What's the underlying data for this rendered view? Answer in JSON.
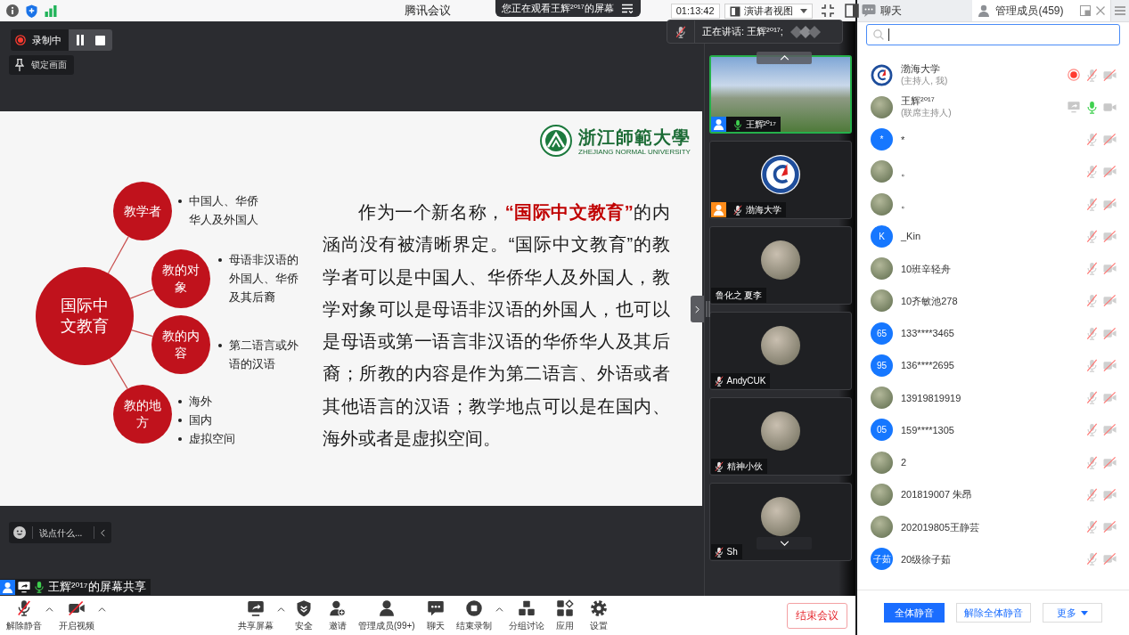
{
  "top_bar": {
    "title": "腾讯会议",
    "viewing_notice": "您正在观看王辉²⁰¹⁷的屏幕",
    "timer": "01:13:42",
    "view_mode": "演讲者视图"
  },
  "recording": {
    "label": "录制中",
    "lock_label": "锁定画面"
  },
  "speaking": {
    "label": "正在讲话: 王辉²⁰¹⁷;"
  },
  "slide": {
    "logo": {
      "title": "浙江師範大學",
      "subtitle": "ZHEJIANG NORMAL UNIVERSITY"
    },
    "mind_map": {
      "center": "国际中文教育",
      "branches": [
        {
          "label": "教学者",
          "points": [
            "中国人、华侨华人及外国人"
          ]
        },
        {
          "label": "教的对象",
          "points": [
            "母语非汉语的外国人、华侨及其后裔"
          ]
        },
        {
          "label": "教的内容",
          "points": [
            "第二语言或外语的汉语"
          ]
        },
        {
          "label": "教的地方",
          "points": [
            "海外",
            "国内",
            "虚拟空间"
          ]
        }
      ]
    },
    "paragraph": "作为一个新名称，**“国际中文教育”**的内涵尚没有被清晰界定。“国际中文教育”的教学者可以是中国人、华侨华人及外国人，教学对象可以是母语非汉语的外国人，也可以是母语或第一语言非汉语的华侨华人及其后裔；所教的内容是作为第二语言、外语或者其他语言的汉语；教学地点可以是在国内、海外或者是虚拟空间。"
  },
  "video_tiles": [
    {
      "name": "王辉²⁰¹⁷",
      "kind": "video",
      "active": true,
      "color": "#1677ff",
      "mic": {
        "muted": false
      }
    },
    {
      "name": "渤海大学",
      "kind": "logo",
      "active": false,
      "color": "#ff8c1a",
      "mic": {
        "muted": true
      }
    },
    {
      "name": "鲁化之 夏李",
      "kind": "avatar",
      "active": false
    },
    {
      "name": "AndyCUK",
      "kind": "avatar",
      "active": false,
      "mic": {
        "muted": true
      }
    },
    {
      "name": "精神小伙",
      "kind": "avatar",
      "active": false,
      "mic": {
        "muted": true
      }
    },
    {
      "name": "Sh",
      "kind": "avatar",
      "active": false,
      "mic": {
        "muted": true
      }
    }
  ],
  "quick_chat": {
    "placeholder": "说点什么..."
  },
  "screen_share": {
    "label": "王辉²⁰¹⁷的屏幕共享"
  },
  "toolbar": {
    "left": [
      {
        "kind": "mic_off",
        "label": "解除静音",
        "menu": true
      },
      {
        "kind": "camera_off",
        "label": "开启视频",
        "menu": true
      }
    ],
    "center": [
      {
        "kind": "share",
        "label": "共享屏幕",
        "menu": true
      },
      {
        "kind": "security",
        "label": "安全",
        "menu": false
      },
      {
        "kind": "invite",
        "label": "邀请",
        "menu": false
      },
      {
        "kind": "members",
        "label": "管理成员(99+)",
        "menu": false
      },
      {
        "kind": "chat",
        "label": "聊天",
        "menu": false
      },
      {
        "kind": "record",
        "label": "结束录制",
        "menu": true
      },
      {
        "kind": "breakout",
        "label": "分组讨论",
        "menu": false
      },
      {
        "kind": "apps",
        "label": "应用",
        "menu": false
      },
      {
        "kind": "settings",
        "label": "设置",
        "menu": false
      }
    ],
    "end_button": "结束会议"
  },
  "side_panel": {
    "tabs": [
      {
        "kind": "chat",
        "label": "聊天",
        "selected": false
      },
      {
        "kind": "members",
        "label": "管理成员(459)",
        "selected": true
      }
    ],
    "search": {
      "focused": true
    },
    "members": [
      {
        "name": "渤海大学",
        "role": "(主持人, 我)",
        "avatar": {
          "kind": "logo"
        },
        "recording": true,
        "sharing": false,
        "muted": true,
        "camera_on": false
      },
      {
        "name": "王辉²⁰¹⁷",
        "role": "(联席主持人)",
        "avatar": {
          "kind": "photo"
        },
        "recording": false,
        "sharing": true,
        "muted": false,
        "camera_on": true
      },
      {
        "name": "*",
        "avatar": {
          "kind": "initials",
          "text": "*"
        },
        "recording": false,
        "sharing": false,
        "muted": true,
        "camera_on": false
      },
      {
        "name": "。",
        "avatar": {
          "kind": "photo"
        },
        "recording": false,
        "sharing": false,
        "muted": true,
        "camera_on": false
      },
      {
        "name": "。",
        "avatar": {
          "kind": "photo"
        },
        "recording": false,
        "sharing": false,
        "muted": true,
        "camera_on": false
      },
      {
        "name": "_Kin",
        "avatar": {
          "kind": "initials",
          "text": "K"
        },
        "recording": false,
        "sharing": false,
        "muted": true,
        "camera_on": false
      },
      {
        "name": "10班辛轻舟",
        "avatar": {
          "kind": "photo"
        },
        "recording": false,
        "sharing": false,
        "muted": true,
        "camera_on": false
      },
      {
        "name": "10齐敏池278",
        "avatar": {
          "kind": "photo"
        },
        "recording": false,
        "sharing": false,
        "muted": true,
        "camera_on": false
      },
      {
        "name": "133****3465",
        "avatar": {
          "kind": "initials",
          "text": "65"
        },
        "recording": false,
        "sharing": false,
        "muted": true,
        "camera_on": false
      },
      {
        "name": "136****2695",
        "avatar": {
          "kind": "initials",
          "text": "95"
        },
        "recording": false,
        "sharing": false,
        "muted": true,
        "camera_on": false
      },
      {
        "name": "13919819919",
        "avatar": {
          "kind": "photo"
        },
        "recording": false,
        "sharing": false,
        "muted": true,
        "camera_on": false
      },
      {
        "name": "159****1305",
        "avatar": {
          "kind": "initials",
          "text": "05"
        },
        "recording": false,
        "sharing": false,
        "muted": true,
        "camera_on": false
      },
      {
        "name": "2",
        "avatar": {
          "kind": "photo"
        },
        "recording": false,
        "sharing": false,
        "muted": true,
        "camera_on": false
      },
      {
        "name": "201819007 朱昂",
        "avatar": {
          "kind": "photo"
        },
        "recording": false,
        "sharing": false,
        "muted": true,
        "camera_on": false
      },
      {
        "name": "202019805王静芸",
        "avatar": {
          "kind": "photo"
        },
        "recording": false,
        "sharing": false,
        "muted": true,
        "camera_on": false
      },
      {
        "name": "20级徐子茹",
        "avatar": {
          "kind": "initials",
          "text": "子茹"
        },
        "recording": false,
        "sharing": false,
        "muted": true,
        "camera_on": false
      }
    ],
    "buttons": [
      {
        "kind": "primary",
        "label": "全体静音"
      },
      {
        "kind": "secondary",
        "label": "解除全体静音"
      },
      {
        "kind": "dropdown",
        "label": "更多"
      }
    ]
  }
}
